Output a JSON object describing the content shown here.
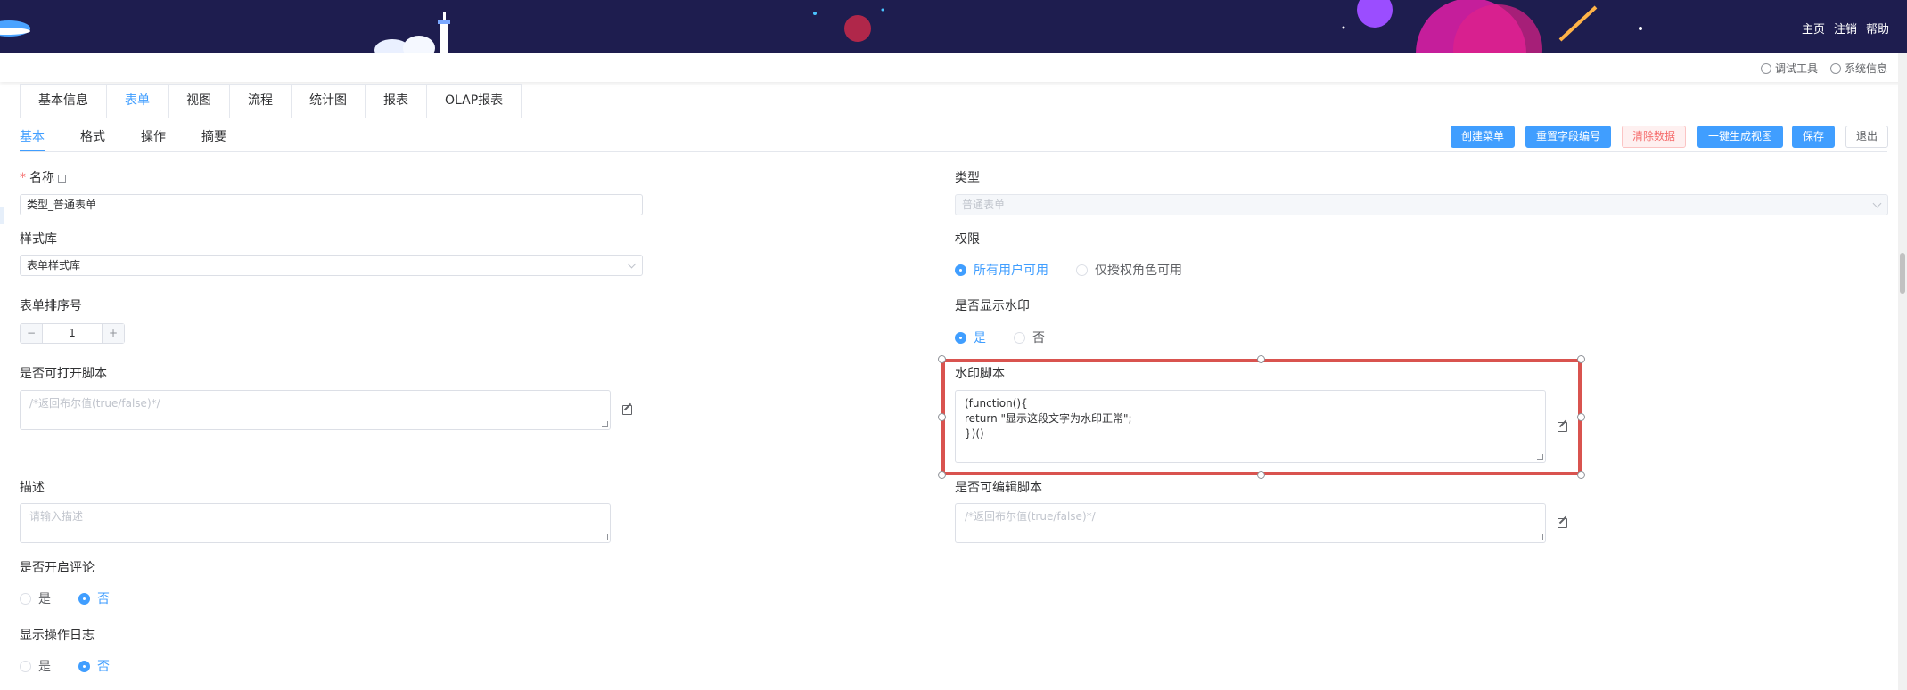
{
  "header": {
    "nav": [
      "主页",
      "注销",
      "帮助"
    ]
  },
  "toolbar": {
    "debug": "调试工具",
    "sysinfo": "系统信息"
  },
  "top_tabs": [
    "基本信息",
    "表单",
    "视图",
    "流程",
    "统计图",
    "报表",
    "OLAP报表"
  ],
  "sub_tabs": [
    "基本",
    "格式",
    "操作",
    "摘要"
  ],
  "actions": {
    "create_menu": "创建菜单",
    "reset_fields": "重置字段编号",
    "clear_data": "清除数据",
    "gen_view": "一键生成视图",
    "save": "保存",
    "exit": "退出"
  },
  "form": {
    "name_label": "名称",
    "name_value": "类型_普通表单",
    "type_label": "类型",
    "type_value": "普通表单",
    "style_label": "样式库",
    "style_value": "表单样式库",
    "perm_label": "权限",
    "perm_opt1": "所有用户可用",
    "perm_opt2": "仅授权角色可用",
    "order_label": "表单排序号",
    "order_value": "1",
    "watermark_label": "是否显示水印",
    "yes": "是",
    "no": "否",
    "open_script_label": "是否可打开脚本",
    "open_script_placeholder": "/*返回布尔值(true/false)*/",
    "wm_script_label": "水印脚本",
    "wm_script_value": "(function(){\nreturn \"显示这段文字为水印正常\";\n})()",
    "desc_label": "描述",
    "desc_placeholder": "请输入描述",
    "edit_script_label": "是否可编辑脚本",
    "edit_script_placeholder": "/*返回布尔值(true/false)*/",
    "comment_label": "是否开启评论",
    "log_label": "显示操作日志"
  },
  "colors": {
    "primary": "#409eff",
    "danger": "#f56c6c",
    "banner": "#1e1d4f",
    "highlight": "#d9534f"
  }
}
